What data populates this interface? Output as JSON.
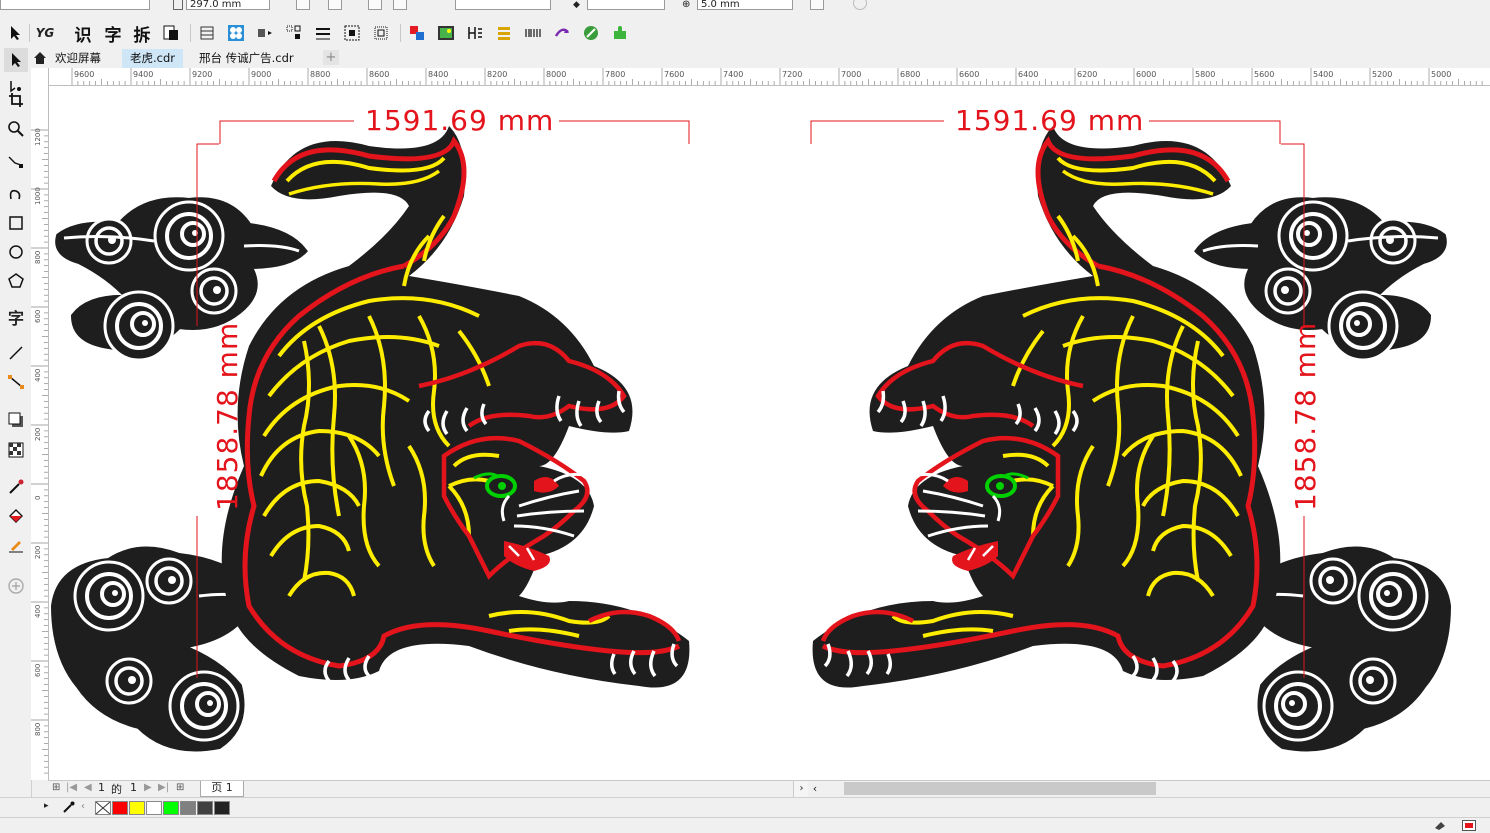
{
  "property_bar": {
    "height_value": "297.0 mm",
    "nudge_value": "5.0 mm"
  },
  "toolbar": {
    "text_recognize": "识",
    "text_char": "字",
    "text_break": "拆"
  },
  "tabs": [
    {
      "label": "欢迎屏幕"
    },
    {
      "label": "老虎.cdr"
    },
    {
      "label": "邢台 传诚广告.cdr"
    }
  ],
  "toolbox": {
    "text_tool": "字"
  },
  "hruler": {
    "labels": [
      "9600",
      "9400",
      "9200",
      "9000",
      "8800",
      "8600",
      "8400",
      "8200",
      "8000",
      "7800",
      "7600",
      "7400",
      "7200",
      "7000",
      "6800",
      "6600",
      "6400",
      "6200",
      "6000",
      "5800",
      "5600",
      "5400",
      "5200",
      "5000"
    ]
  },
  "vruler": {
    "labels": [
      "1200",
      "1000",
      "800",
      "600",
      "400",
      "200",
      "0",
      "200",
      "400",
      "600",
      "800"
    ]
  },
  "dimensions": {
    "left_width": "1591.69 mm",
    "left_height": "1858.78 mm",
    "right_width": "1591.69 mm",
    "right_height": "1858.78 mm"
  },
  "pagebar": {
    "page_current": "1",
    "of_label": "的",
    "page_total": "1",
    "page_tab": "页 1"
  },
  "palette": {
    "colors": [
      "#ff0000",
      "#ffff00",
      "#ffffff",
      "#00ff00",
      "#808080",
      "#404040",
      "#222222"
    ]
  }
}
